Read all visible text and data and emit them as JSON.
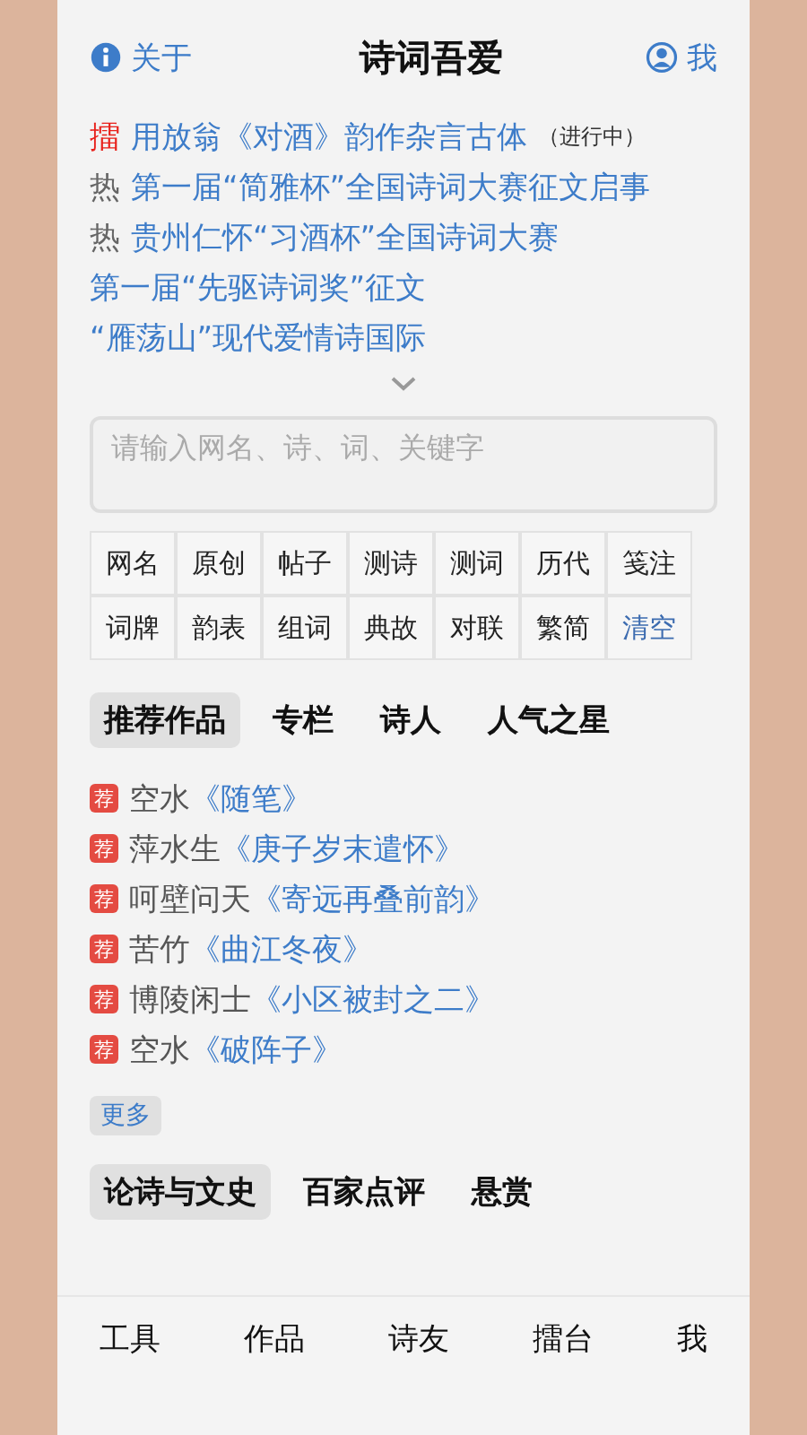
{
  "header": {
    "about": "关于",
    "title": "诗词吾爱",
    "me": "我"
  },
  "news": [
    {
      "tag": "擂",
      "kind": "live",
      "title": "用放翁《对酒》韵作杂言古体",
      "note": "（进行中）"
    },
    {
      "tag": "热",
      "kind": "hot",
      "title": "第一届“简雅杯”全国诗词大赛征文启事"
    },
    {
      "tag": "热",
      "kind": "hot",
      "title": "贵州仁怀“习酒杯”全国诗词大赛"
    },
    {
      "title": "第一届“先驱诗词奖”征文"
    },
    {
      "title": "“雁荡山”现代爱情诗国际"
    }
  ],
  "search": {
    "placeholder": "请输入网名、诗、词、关键字"
  },
  "filters": [
    [
      {
        "label": "网名",
        "kind": "filter"
      },
      {
        "label": "原创",
        "kind": "filter"
      },
      {
        "label": "帖子",
        "kind": "filter"
      },
      {
        "label": "测诗",
        "kind": "filter"
      },
      {
        "label": "测词",
        "kind": "filter"
      },
      {
        "label": "历代",
        "kind": "filter"
      },
      {
        "label": "笺注",
        "kind": "filter"
      }
    ],
    [
      {
        "label": "词牌",
        "kind": "filter"
      },
      {
        "label": "韵表",
        "kind": "filter"
      },
      {
        "label": "组词",
        "kind": "filter"
      },
      {
        "label": "典故",
        "kind": "filter"
      },
      {
        "label": "对联",
        "kind": "filter"
      },
      {
        "label": "繁简",
        "kind": "filter"
      },
      {
        "label": "清空",
        "kind": "clear"
      }
    ]
  ],
  "tabs": [
    {
      "label": "推荐作品",
      "selected": true
    },
    {
      "label": "专栏",
      "selected": false
    },
    {
      "label": "诗人",
      "selected": false
    },
    {
      "label": "人气之星",
      "selected": false
    }
  ],
  "works": [
    {
      "badge": "荐",
      "author": "空水",
      "title": "《随笔》"
    },
    {
      "badge": "荐",
      "author": "萍水生",
      "title": "《庚子岁末遣怀》"
    },
    {
      "badge": "荐",
      "author": "呵壁问天",
      "title": "《寄远再叠前韵》"
    },
    {
      "badge": "荐",
      "author": "苦竹",
      "title": "《曲江冬夜》"
    },
    {
      "badge": "荐",
      "author": "博陵闲士",
      "title": "《小区被封之二》"
    },
    {
      "badge": "荐",
      "author": "空水",
      "title": "《破阵子》"
    }
  ],
  "more": "更多",
  "tabs2": [
    {
      "label": "论诗与文史",
      "selected": true
    },
    {
      "label": "百家点评",
      "selected": false
    },
    {
      "label": "悬赏",
      "selected": false
    }
  ],
  "bottom_nav": [
    "工具",
    "作品",
    "诗友",
    "擂台",
    "我"
  ]
}
